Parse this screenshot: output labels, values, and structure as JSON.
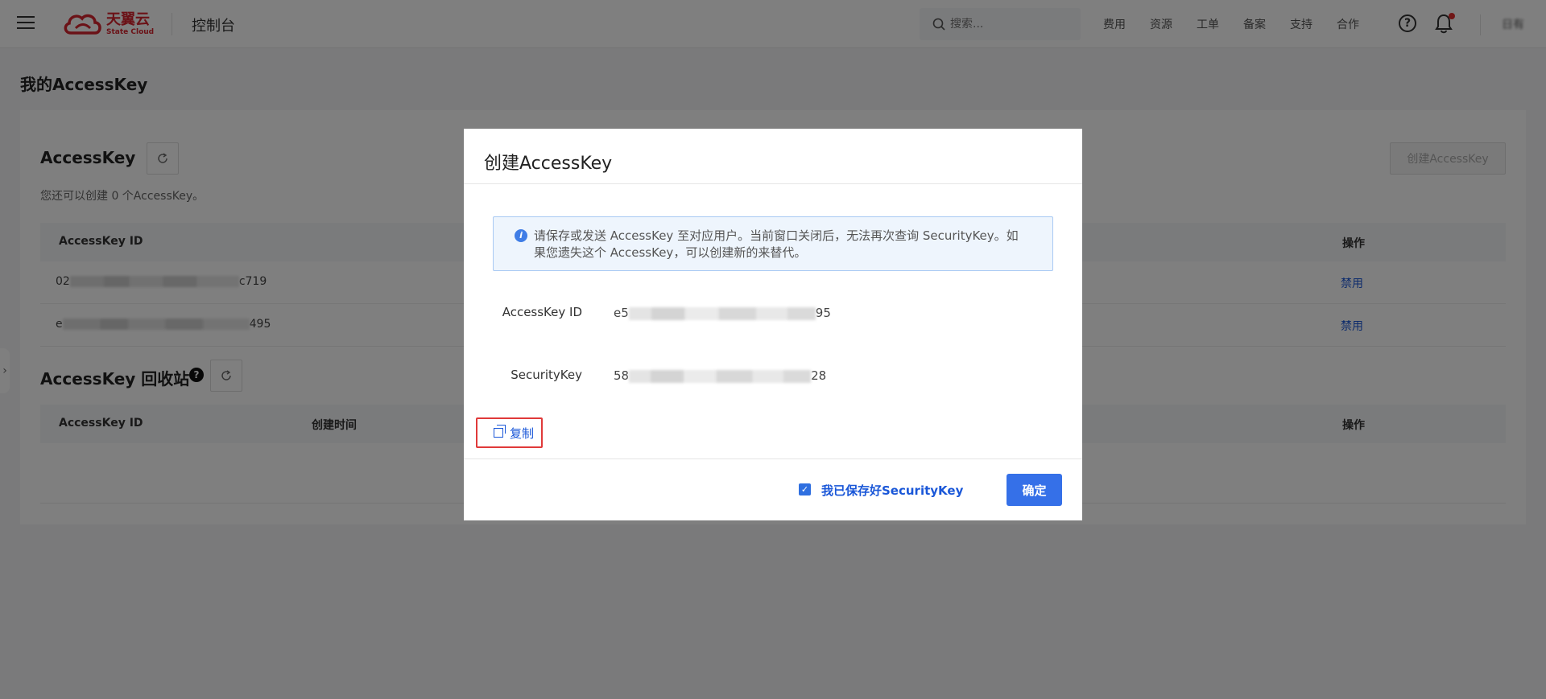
{
  "nav": {
    "logo_cn": "天翼云",
    "logo_en": "State Cloud",
    "console_title": "控制台",
    "search_placeholder": "搜索...",
    "links": [
      "费用",
      "资源",
      "工单",
      "备案",
      "支持",
      "合作"
    ],
    "help": "?",
    "user": "日有"
  },
  "page": {
    "title": "我的AccessKey",
    "accesskey_section": {
      "title": "AccessKey",
      "hint": "您还可以创建 0 个AccessKey。",
      "create_button": "创建AccessKey",
      "headers": {
        "id": "AccessKey ID",
        "action": "操作"
      },
      "rows": [
        {
          "prefix": "02",
          "suffix": "c719",
          "action": "禁用"
        },
        {
          "prefix": "e",
          "suffix": "495",
          "action": "禁用"
        }
      ]
    },
    "recycle_section": {
      "title": "AccessKey 回收站",
      "help": "?",
      "headers": {
        "id": "AccessKey ID",
        "created": "创建时间",
        "action": "操作"
      }
    }
  },
  "modal": {
    "title": "创建AccessKey",
    "alert_icon": "i",
    "alert_text": "请保存或发送 AccessKey 至对应用户。当前窗口关闭后，无法再次查询 SecurityKey。如果您遗失这个 AccessKey，可以创建新的来替代。",
    "id_label": "AccessKey ID",
    "id_prefix": "e5",
    "id_suffix": "95",
    "secret_label": "SecurityKey",
    "secret_prefix": "58",
    "secret_suffix": "28",
    "copy_label": "复制",
    "checkbox_label": "我已保存好SecurityKey",
    "checkbox_checked": true,
    "checkbox_mark": "✓",
    "confirm_label": "确定"
  },
  "colors": {
    "brand": "#d7242f",
    "primary": "#3570e8",
    "link": "#1a57d8",
    "highlight": "#e03a3a"
  }
}
